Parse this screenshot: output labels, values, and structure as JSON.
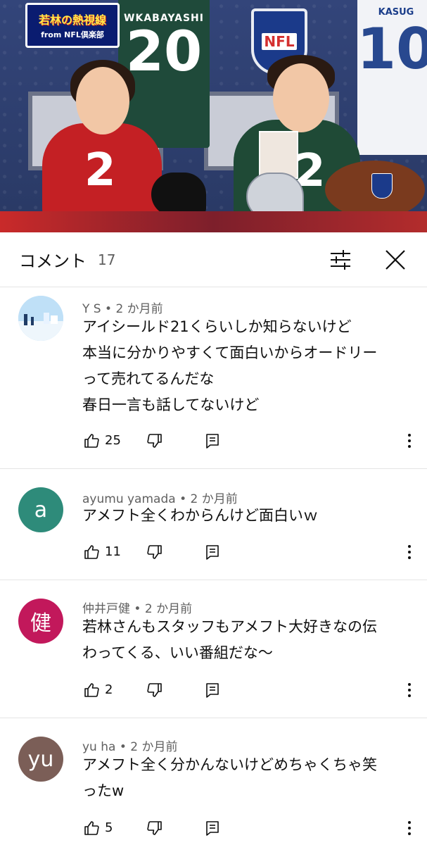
{
  "video": {
    "logo_main": "若林の熱視線",
    "logo_sub": "from NFL倶楽部",
    "jersey_left_name": "WKABAYASHI",
    "jersey_left_number": "20",
    "jersey_right_name": "KASUG",
    "jersey_right_number": "10",
    "shield_text": "NFL",
    "host_left_number": "2",
    "host_right_number": "2"
  },
  "comments_header": {
    "title": "コメント",
    "count": "17",
    "filter_icon": "filter-sliders-icon",
    "close_icon": "close-icon"
  },
  "comments": [
    {
      "author": "Y S",
      "time": "2 か月前",
      "avatar_type": "image",
      "lines": [
        "アイシールド21くらいしか知らないけど",
        "本当に分かりやすくて面白いからオードリー",
        "って売れてるんだな",
        "春日一言も話してないけど"
      ],
      "likes": "25"
    },
    {
      "author": "ayumu yamada",
      "time": "2 か月前",
      "avatar_letter": "a",
      "avatar_color": "#2e8b7a",
      "lines": [
        "アメフト全くわからんけど面白いｗ"
      ],
      "likes": "11"
    },
    {
      "author": "仲井戸健",
      "time": "2 か月前",
      "avatar_letter": "健",
      "avatar_color": "#c2185b",
      "lines": [
        "若林さんもスタッフもアメフト大好きなの伝",
        "わってくる、いい番組だな〜"
      ],
      "likes": "2"
    },
    {
      "author": "yu ha",
      "time": "2 か月前",
      "avatar_letter": "yu",
      "avatar_color": "#7b5e57",
      "lines": [
        "アメフト全く分かんないけどめちゃくちゃ笑",
        "ったw"
      ],
      "likes": "5"
    }
  ],
  "colors": {
    "divider": "#e5e5e5",
    "secondary_text": "#606060",
    "primary_text": "#0f0f0f"
  }
}
